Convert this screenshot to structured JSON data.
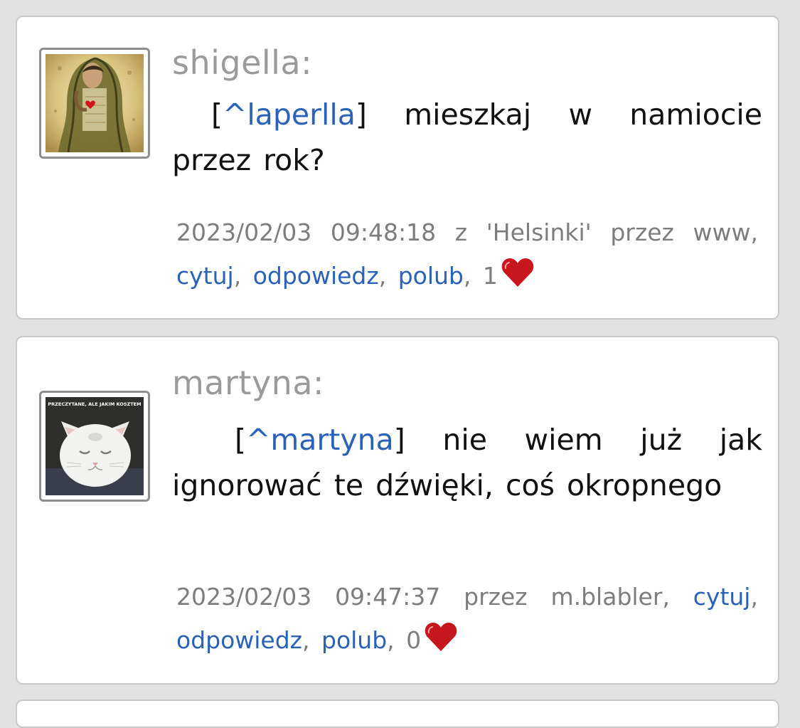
{
  "posts": [
    {
      "author": "shigella:",
      "reply_open": "[",
      "reply_to": "^laperlla",
      "reply_close": "]",
      "message": " mieszkaj w namiocie przez rok?",
      "date": "2023/02/03",
      "time": "09:48:18",
      "from_label": "z",
      "location": "'Helsinki'",
      "via_label": "przez",
      "via": "www",
      "actions": {
        "quote": "cytuj",
        "reply": "odpowiedz",
        "like": "polub"
      },
      "likes": "1",
      "avatar": "woman-holding-heart-painting"
    },
    {
      "author": "martyna:",
      "reply_open": "[",
      "reply_to": "^martyna",
      "reply_close": "]",
      "message": " nie wiem już jak ignorować te dźwięki, coś okropnego",
      "date": "2023/02/03",
      "time": "09:47:37",
      "via_label": "przez",
      "via": "m.blabler",
      "actions": {
        "quote": "cytuj",
        "reply": "odpowiedz",
        "like": "polub"
      },
      "likes": "0",
      "avatar": "sad-white-kitten-meme",
      "avatar_caption": "PRZECZYTANE, ALE JAKIM KOSZTEM"
    }
  ],
  "colors": {
    "background": "#e2e2e2",
    "card": "#ffffff",
    "link": "#2a62b8",
    "author": "#9a9a9a",
    "meta": "#7d7d7d",
    "heart": "#c8161d"
  }
}
